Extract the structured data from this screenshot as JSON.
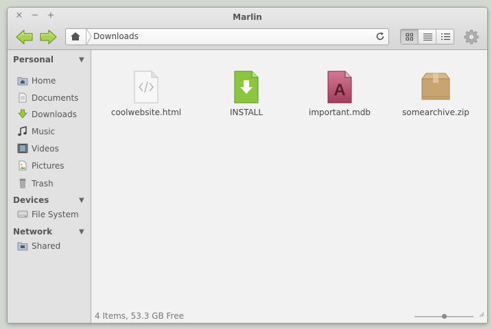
{
  "window": {
    "title": "Marlin",
    "close": "×",
    "minimize": "−",
    "maximize": "+"
  },
  "toolbar": {
    "back_icon": "back-arrow-icon",
    "forward_icon": "forward-arrow-icon",
    "path": "Downloads",
    "view_modes": [
      "icon-view",
      "list-view",
      "column-view"
    ],
    "active_view": "icon-view",
    "settings_icon": "gear-icon"
  },
  "sidebar": {
    "sections": [
      {
        "title": "Personal",
        "items": [
          {
            "label": "Home",
            "icon": "home-folder-icon"
          },
          {
            "label": "Documents",
            "icon": "documents-icon"
          },
          {
            "label": "Downloads",
            "icon": "downloads-icon"
          },
          {
            "label": "Music",
            "icon": "music-icon"
          },
          {
            "label": "Videos",
            "icon": "videos-icon"
          },
          {
            "label": "Pictures",
            "icon": "pictures-icon"
          },
          {
            "label": "Trash",
            "icon": "trash-icon"
          }
        ]
      },
      {
        "title": "Devices",
        "items": [
          {
            "label": "File System",
            "icon": "drive-icon"
          }
        ]
      },
      {
        "title": "Network",
        "items": [
          {
            "label": "Shared",
            "icon": "network-folder-icon"
          }
        ]
      }
    ]
  },
  "files": [
    {
      "name": "coolwebsite.html",
      "icon": "html-file-icon"
    },
    {
      "name": "INSTALL",
      "icon": "install-file-icon"
    },
    {
      "name": "important.mdb",
      "icon": "database-file-icon"
    },
    {
      "name": "somearchive.zip",
      "icon": "archive-icon"
    }
  ],
  "status": {
    "text": "4 Items, 53.3 GB Free",
    "zoom_level": 0.5
  },
  "colors": {
    "accent_green": "#8cc63f",
    "sidebar_bg": "#e2e2e2",
    "content_bg": "#f2f2f2"
  }
}
